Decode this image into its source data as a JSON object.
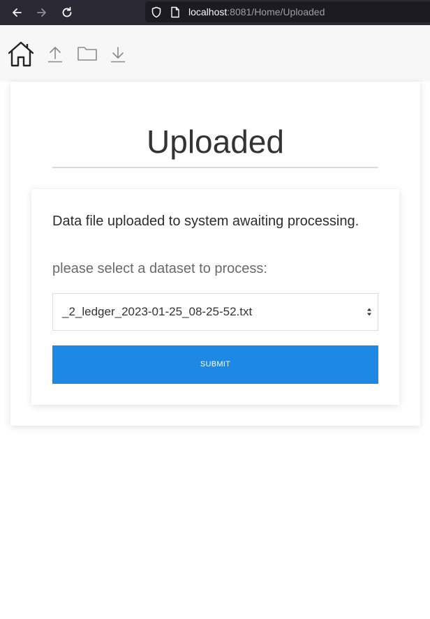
{
  "browser": {
    "url_host": "localhost",
    "url_rest": ":8081/Home/Uploaded",
    "icons": {
      "back": "back-arrow-icon",
      "forward": "forward-arrow-icon",
      "reload": "reload-icon",
      "security": "shield-icon",
      "page": "page-icon"
    }
  },
  "toolbar": {
    "icons": [
      "home-icon",
      "upload-icon",
      "folder-icon",
      "download-icon"
    ]
  },
  "main": {
    "title": "Uploaded",
    "status_message": "Data file uploaded to system awaiting processing.",
    "prompt": "please select a dataset to process:",
    "dataset_select": {
      "selected": "_2_ledger_2023-01-25_08-25-52.txt"
    },
    "submit_label": "SUBMIT"
  },
  "colors": {
    "browser_chrome": "#2b2a33",
    "urlbar": "#1c1b22",
    "toolbar_bg": "#f7f7f7",
    "accent": "#1e88e5",
    "title_text": "#333333"
  }
}
